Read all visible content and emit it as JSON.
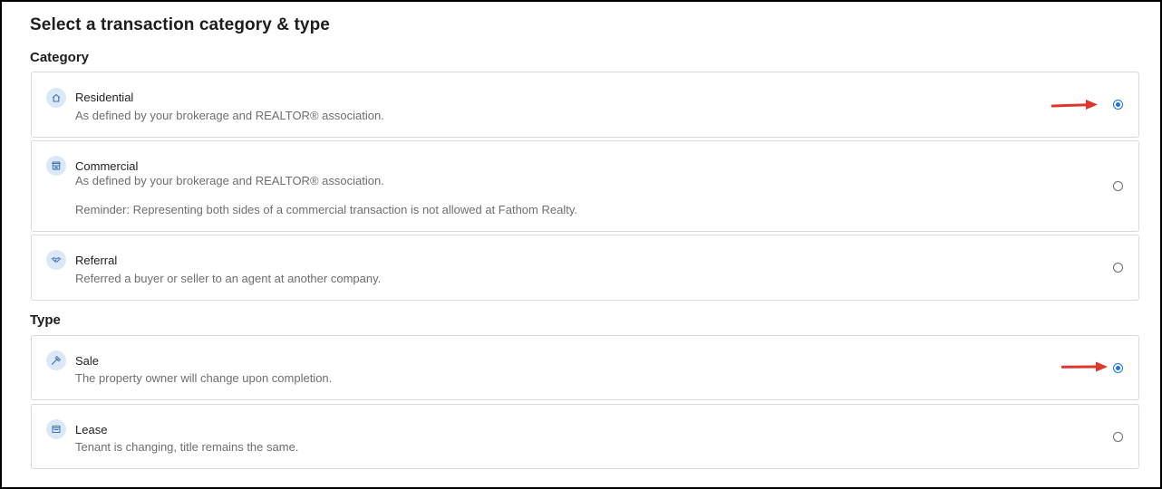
{
  "title": "Select a transaction category & type",
  "category": {
    "heading": "Category",
    "options": [
      {
        "label": "Residential",
        "description": "As defined by your brokerage and REALTOR® association.",
        "icon": "house-icon",
        "selected": true
      },
      {
        "label": "Commercial",
        "description": "As defined by your brokerage and REALTOR® association.",
        "note": "Reminder: Representing both sides of a commercial transaction is not allowed at Fathom Realty.",
        "icon": "storefront-icon",
        "selected": false
      },
      {
        "label": "Referral",
        "description": "Referred a buyer or seller to an agent at another company.",
        "icon": "handshake-icon",
        "selected": false
      }
    ]
  },
  "type": {
    "heading": "Type",
    "options": [
      {
        "label": "Sale",
        "description": "The property owner will change upon completion.",
        "icon": "gavel-icon",
        "selected": true
      },
      {
        "label": "Lease",
        "description": "Tenant is changing, title remains the same.",
        "icon": "lease-icon",
        "selected": false
      }
    ]
  },
  "colors": {
    "accent": "#1a73e8",
    "icon_bg": "#dbe8f8",
    "icon_fg": "#3b6fb6",
    "annotation_arrow": "#e0352b",
    "border": "#d9d9d9",
    "muted_text": "#6e6e6e"
  }
}
